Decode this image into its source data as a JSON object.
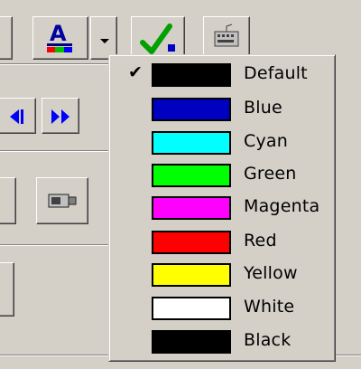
{
  "menu": {
    "items": [
      {
        "label": "Default",
        "color": "#000000",
        "checked": true
      },
      {
        "label": "Blue",
        "color": "#0000c0",
        "checked": false
      },
      {
        "label": "Cyan",
        "color": "#00ffff",
        "checked": false
      },
      {
        "label": "Green",
        "color": "#00ff00",
        "checked": false
      },
      {
        "label": "Magenta",
        "color": "#ff00ff",
        "checked": false
      },
      {
        "label": "Red",
        "color": "#ff0000",
        "checked": false
      },
      {
        "label": "Yellow",
        "color": "#ffff00",
        "checked": false
      },
      {
        "label": "White",
        "color": "#ffffff",
        "checked": false
      },
      {
        "label": "Black",
        "color": "#000000",
        "checked": false
      }
    ],
    "check_glyph": "✔"
  },
  "toolbar": {
    "font_color_icon": "font-color-icon",
    "dropdown_arrow_icon": "chevron-down-icon",
    "check_icon": "green-check-icon",
    "keyboard_icon": "keyboard-icon",
    "nav_prev_icon": "arrow-left-icon",
    "nav_next_icon": "double-arrow-right-icon",
    "camera_icon": "camera-icon",
    "font_color_letter": "A"
  }
}
